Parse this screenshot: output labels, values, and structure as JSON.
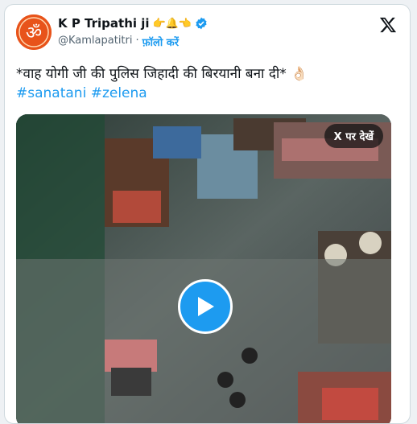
{
  "author": {
    "name": "K P Tripathi ji",
    "emoji": "👉🔔👈",
    "handle": "@Kamlapatitri",
    "separator": "·",
    "follow_label": "फ़ॉलो करें"
  },
  "tweet": {
    "text": "*वाह योगी जी की पुलिस जिहादी की बिरयानी बना दी* 👌🏻",
    "hashtags": [
      "#sanatani",
      "#zelena"
    ]
  },
  "media": {
    "watch_on_x_label": "X पर देखें"
  },
  "colors": {
    "accent": "#1d9bf0",
    "avatar_bg": "#e8531a"
  },
  "icons": [
    "om-avatar",
    "verified-badge-icon",
    "x-logo-icon",
    "play-icon"
  ]
}
